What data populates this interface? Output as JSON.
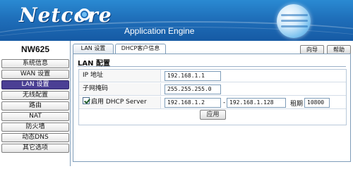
{
  "header": {
    "brand": "Netcore",
    "subtitle": "Application Engine"
  },
  "sidebar": {
    "model": "NW625",
    "items": [
      {
        "label": "系统信息"
      },
      {
        "label": "WAN 设置"
      },
      {
        "label": "LAN 设置",
        "active": true
      },
      {
        "label": "无线配置"
      },
      {
        "label": "路由"
      },
      {
        "label": "NAT"
      },
      {
        "label": "防火墙"
      },
      {
        "label": "动态DNS"
      },
      {
        "label": "其它选项"
      }
    ]
  },
  "tabs": [
    {
      "label": "LAN 设置"
    },
    {
      "label": "DHCP客户信息"
    }
  ],
  "toolbar": {
    "wizard_label": "向导",
    "help_label": "帮助"
  },
  "panel": {
    "title": "LAN 配置",
    "ip_label": "IP  地址",
    "ip_value": "192.168.1.1",
    "mask_label": "子网掩码",
    "mask_value": "255.255.255.0",
    "dhcp_label": "启用  DHCP Server",
    "dhcp_enabled": true,
    "dhcp_start": "192.168.1.2",
    "range_separator": "-",
    "dhcp_end": "192.168.1.128",
    "lease_label": "租期",
    "lease_value": "10800",
    "apply_label": "应用"
  },
  "colors": {
    "header_blue": "#1f6fba",
    "active_menu": "#4b3f94",
    "border": "#7f9db9"
  }
}
